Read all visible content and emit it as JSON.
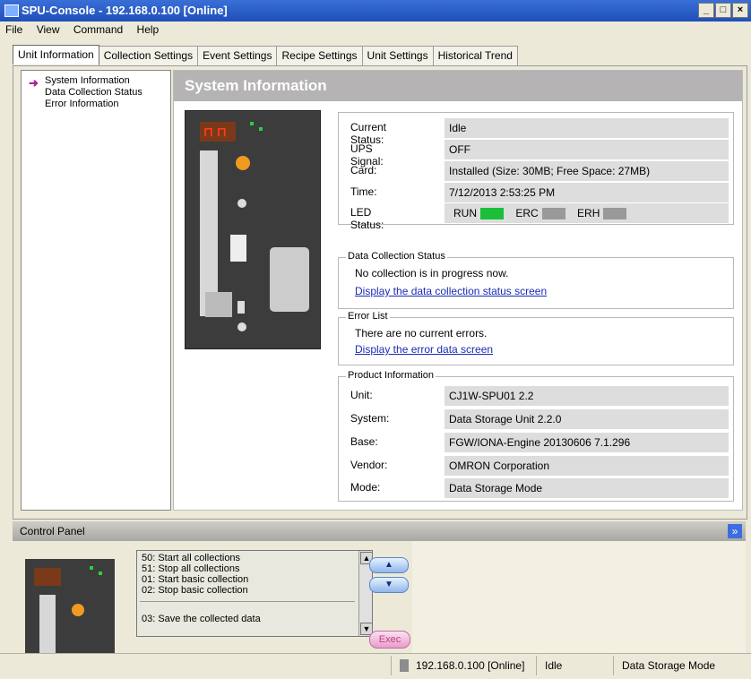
{
  "window": {
    "title": "SPU-Console - 192.168.0.100 [Online]",
    "buttons": [
      "_",
      "□",
      "×"
    ]
  },
  "menu": [
    "File",
    "View",
    "Command",
    "Help"
  ],
  "tabs": [
    "Unit Information",
    "Collection Settings",
    "Event Settings",
    "Recipe Settings",
    "Unit Settings",
    "Historical Trend"
  ],
  "tree": {
    "items": [
      "System Information",
      "Data Collection Status",
      "Error Information"
    ]
  },
  "system": {
    "header": "System Information",
    "status_rows": [
      {
        "label": "Current Status:",
        "value": "Idle"
      },
      {
        "label": "UPS Signal:",
        "value": "OFF"
      },
      {
        "label": "Card:",
        "value": "Installed  (Size: 30MB; Free Space: 27MB)"
      },
      {
        "label": "Time:",
        "value": "7/12/2013 2:53:25 PM"
      }
    ],
    "led_label": "LED Status:",
    "leds": [
      {
        "name": "RUN",
        "color": "#1bbf3a"
      },
      {
        "name": "ERC",
        "color": "#9a9a9a"
      },
      {
        "name": "ERH",
        "color": "#9a9a9a"
      }
    ]
  },
  "data_collection": {
    "legend": "Data Collection Status",
    "message": "No collection is in progress now.",
    "link": "Display the data collection status screen"
  },
  "error_list": {
    "legend": "Error List",
    "message": "There are no current errors.",
    "link": "Display the error data screen"
  },
  "product": {
    "legend": "Product Information",
    "rows": [
      {
        "label": "Unit:",
        "value": "CJ1W-SPU01        2.2"
      },
      {
        "label": "System:",
        "value": "Data Storage Unit  2.2.0"
      },
      {
        "label": "Base:",
        "value": "FGW/IONA-Engine 20130606  7.1.296"
      },
      {
        "label": "Vendor:",
        "value": "OMRON Corporation"
      },
      {
        "label": "Mode:",
        "value": "Data Storage Mode"
      }
    ]
  },
  "control_panel": {
    "title": "Control Panel",
    "commands": [
      "50: Start all collections",
      "51: Stop all collections",
      "01: Start basic collection",
      "02: Stop basic collection",
      "03: Save the collected data"
    ],
    "up_label": "▲",
    "down_label": "▼",
    "exec_label": "Exec"
  },
  "statusbar": {
    "address": "192.168.0.100 [Online]",
    "state": "Idle",
    "mode": "Data Storage Mode"
  }
}
